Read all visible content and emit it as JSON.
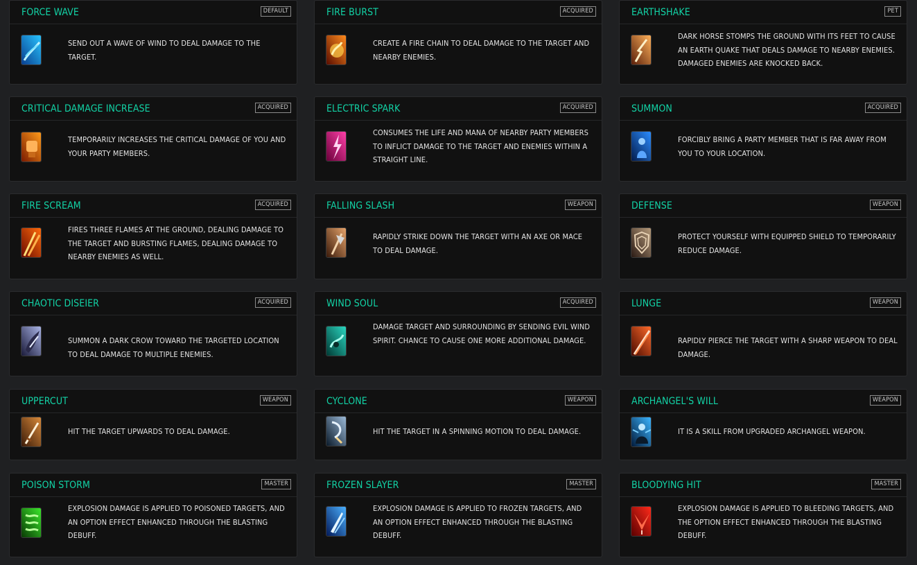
{
  "skills": [
    {
      "title": "FORCE WAVE",
      "badge": "DEFAULT",
      "description": "SEND OUT A WAVE OF WIND TO DEAL DAMAGE TO THE TARGET.",
      "icon": "wind-wave-icon",
      "colors": [
        "#0a3f8f",
        "#27c4ff"
      ]
    },
    {
      "title": "FIRE BURST",
      "badge": "ACQUIRED",
      "description": "CREATE A FIRE CHAIN TO DEAL DAMAGE TO THE TARGET AND NEARBY ENEMIES.",
      "icon": "fire-chain-icon",
      "colors": [
        "#5a0d00",
        "#ff8a1c"
      ]
    },
    {
      "title": "EARTHSHAKE",
      "badge": "PET",
      "description": "DARK HORSE STOMPS THE GROUND WITH ITS FEET TO CAUSE AN EARTH QUAKE THAT DEALS DAMAGE TO NEARBY ENEMIES. DAMAGED ENEMIES ARE KNOCKED BACK.",
      "icon": "earthquake-icon",
      "colors": [
        "#5a1f0a",
        "#ffb15a"
      ]
    },
    {
      "title": "CRITICAL DAMAGE INCREASE",
      "badge": "ACQUIRED",
      "description": "TEMPORARILY INCREASES THE CRITICAL DAMAGE OF YOU AND YOUR PARTY MEMBERS.",
      "icon": "fist-icon",
      "colors": [
        "#7a1a00",
        "#ff9a1a"
      ]
    },
    {
      "title": "ELECTRIC SPARK",
      "badge": "ACQUIRED",
      "description": "CONSUMES THE LIFE AND MANA OF NEARBY PARTY MEMBERS TO INFLICT DAMAGE TO THE TARGET AND ENEMIES WITHIN A STRAIGHT LINE.",
      "icon": "lightning-icon",
      "colors": [
        "#6a003a",
        "#ff3fa8"
      ]
    },
    {
      "title": "SUMMON",
      "badge": "ACQUIRED",
      "description": "FORCIBLY BRING A PARTY MEMBER THAT IS FAR AWAY FROM YOU TO YOUR LOCATION.",
      "icon": "summon-figure-icon",
      "colors": [
        "#031a4a",
        "#2a8cff"
      ]
    },
    {
      "title": "FIRE SCREAM",
      "badge": "ACQUIRED",
      "description": "FIRES THREE FLAMES AT THE GROUND, DEALING DAMAGE TO THE TARGET AND BURSTING FLAMES, DEALING DAMAGE TO NEARBY ENEMIES AS WELL.",
      "icon": "flames-icon",
      "colors": [
        "#6a0a00",
        "#ff6a0a"
      ]
    },
    {
      "title": "FALLING SLASH",
      "badge": "WEAPON",
      "description": "RAPIDLY STRIKE DOWN THE TARGET WITH AN AXE OR MACE TO DEAL DAMAGE.",
      "icon": "axe-icon",
      "colors": [
        "#3a1a0a",
        "#e6a36a"
      ]
    },
    {
      "title": "DEFENSE",
      "badge": "WEAPON",
      "description": "PROTECT YOURSELF WITH EQUIPPED SHIELD TO TEMPORARILY REDUCE DAMAGE.",
      "icon": "shield-icon",
      "colors": [
        "#2a1a14",
        "#b59a7a"
      ]
    },
    {
      "title": "CHAOTIC DISEIER",
      "badge": "ACQUIRED",
      "description": "SUMMON A DARK CROW TOWARD THE TARGETED LOCATION TO DEAL DAMAGE TO MULTIPLE ENEMIES.",
      "icon": "crow-icon",
      "colors": [
        "#1a1a3a",
        "#a9b4e6"
      ]
    },
    {
      "title": "WIND SOUL",
      "badge": "ACQUIRED",
      "description": "DAMAGE TARGET AND SURROUNDING BY SENDING EVIL WIND SPIRIT. CHANCE TO CAUSE ONE MORE ADDITIONAL DAMAGE.",
      "icon": "wind-spirit-icon",
      "colors": [
        "#003a34",
        "#2ad6c0"
      ]
    },
    {
      "title": "LUNGE",
      "badge": "WEAPON",
      "description": "RAPIDLY PIERCE THE TARGET WITH A SHARP WEAPON TO DEAL DAMAGE.",
      "icon": "lunge-icon",
      "colors": [
        "#4a0a00",
        "#ff6a2a"
      ]
    },
    {
      "title": "UPPERCUT",
      "badge": "WEAPON",
      "description": "HIT THE TARGET UPWARDS TO DEAL DAMAGE.",
      "icon": "sword-icon",
      "colors": [
        "#3a1a08",
        "#d98a3a"
      ]
    },
    {
      "title": "CYCLONE",
      "badge": "WEAPON",
      "description": "HIT THE TARGET IN A SPINNING MOTION TO DEAL DAMAGE.",
      "icon": "cyclone-icon",
      "colors": [
        "#0a1a2a",
        "#9ab8d6"
      ]
    },
    {
      "title": "ARCHANGEL'S WILL",
      "badge": "WEAPON",
      "description": "IT IS A SKILL FROM UPGRADED ARCHANGEL WEAPON.",
      "icon": "archangel-icon",
      "colors": [
        "#031a3a",
        "#3ab4ff"
      ]
    },
    {
      "title": "POISON STORM",
      "badge": "MASTER",
      "description": "EXPLOSION DAMAGE IS APPLIED TO POISONED TARGETS, AND AN OPTION EFFECT ENHANCED THROUGH THE BLASTING DEBUFF.",
      "icon": "poison-storm-icon",
      "colors": [
        "#0a3a05",
        "#3ae62a"
      ]
    },
    {
      "title": "FROZEN SLAYER",
      "badge": "MASTER",
      "description": "EXPLOSION DAMAGE IS APPLIED TO FROZEN TARGETS, AND AN OPTION EFFECT ENHANCED THROUGH THE BLASTING DEBUFF.",
      "icon": "ice-shard-icon",
      "colors": [
        "#031a5a",
        "#4ab0ff"
      ]
    },
    {
      "title": "BLOODYING HIT",
      "badge": "MASTER",
      "description": "EXPLOSION DAMAGE IS APPLIED TO BLEEDING TARGETS, AND THE OPTION EFFECT ENHANCED THROUGH THE BLASTING DEBUFF.",
      "icon": "blood-slash-icon",
      "colors": [
        "#5a0000",
        "#ff2a1a"
      ]
    }
  ]
}
